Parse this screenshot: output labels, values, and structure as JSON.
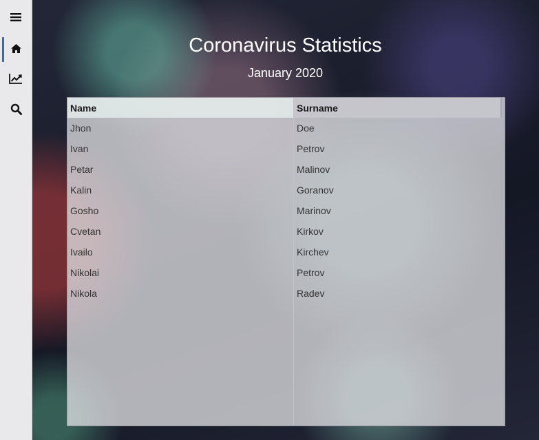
{
  "sidebar": {
    "items": [
      {
        "icon": "hamburger-menu-icon",
        "active": false
      },
      {
        "icon": "home-icon",
        "active": true
      },
      {
        "icon": "chart-line-icon",
        "active": false
      },
      {
        "icon": "search-icon",
        "active": false
      }
    ],
    "active_color": "#2f6fbf"
  },
  "main": {
    "title": "Coronavirus Statistics",
    "subtitle": "January 2020"
  },
  "table": {
    "columns": [
      "Name",
      "Surname"
    ],
    "rows": [
      [
        "Jhon",
        "Doe"
      ],
      [
        "Ivan",
        "Petrov"
      ],
      [
        "Petar",
        "Malinov"
      ],
      [
        "Kalin",
        "Goranov"
      ],
      [
        "Gosho",
        "Marinov"
      ],
      [
        "Cvetan",
        "Kirkov"
      ],
      [
        "Ivailo",
        "Kirchev"
      ],
      [
        "Nikolai",
        "Petrov"
      ],
      [
        "Nikola",
        "Radev"
      ]
    ]
  }
}
